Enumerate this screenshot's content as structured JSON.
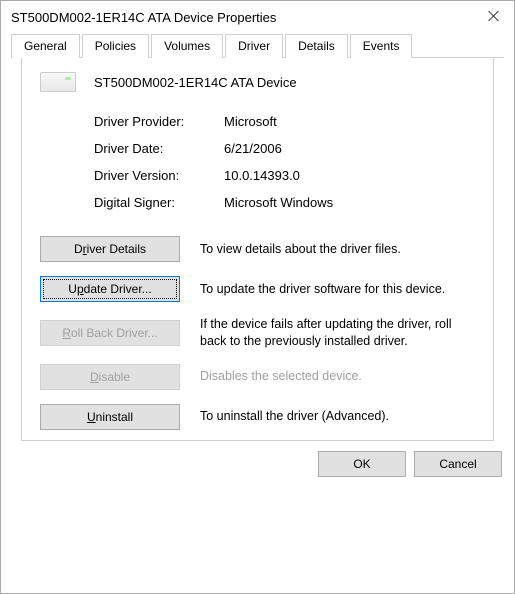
{
  "window": {
    "title": "ST500DM002-1ER14C ATA Device Properties"
  },
  "tabs": {
    "items": [
      {
        "label": "General"
      },
      {
        "label": "Policies"
      },
      {
        "label": "Volumes"
      },
      {
        "label": "Driver",
        "active": true
      },
      {
        "label": "Details"
      },
      {
        "label": "Events"
      }
    ]
  },
  "device": {
    "name": "ST500DM002-1ER14C ATA Device"
  },
  "info": {
    "provider_label": "Driver Provider:",
    "provider_value": "Microsoft",
    "date_label": "Driver Date:",
    "date_value": "6/21/2006",
    "version_label": "Driver Version:",
    "version_value": "10.0.14393.0",
    "signer_label": "Digital Signer:",
    "signer_value": "Microsoft Windows"
  },
  "actions": {
    "details": {
      "label_pre": "D",
      "label_u": "r",
      "label_post": "iver Details",
      "desc": "To view details about the driver files."
    },
    "update": {
      "label_pre": "U",
      "label_u": "p",
      "label_post": "date Driver...",
      "desc": "To update the driver software for this device."
    },
    "rollback": {
      "label_pre": "",
      "label_u": "R",
      "label_post": "oll Back Driver...",
      "desc": "If the device fails after updating the driver, roll back to the previously installed driver."
    },
    "disable": {
      "label_pre": "",
      "label_u": "D",
      "label_post": "isable",
      "desc": "Disables the selected device."
    },
    "uninstall": {
      "label_pre": "",
      "label_u": "U",
      "label_post": "ninstall",
      "desc": "To uninstall the driver (Advanced)."
    }
  },
  "footer": {
    "ok": "OK",
    "cancel": "Cancel"
  }
}
